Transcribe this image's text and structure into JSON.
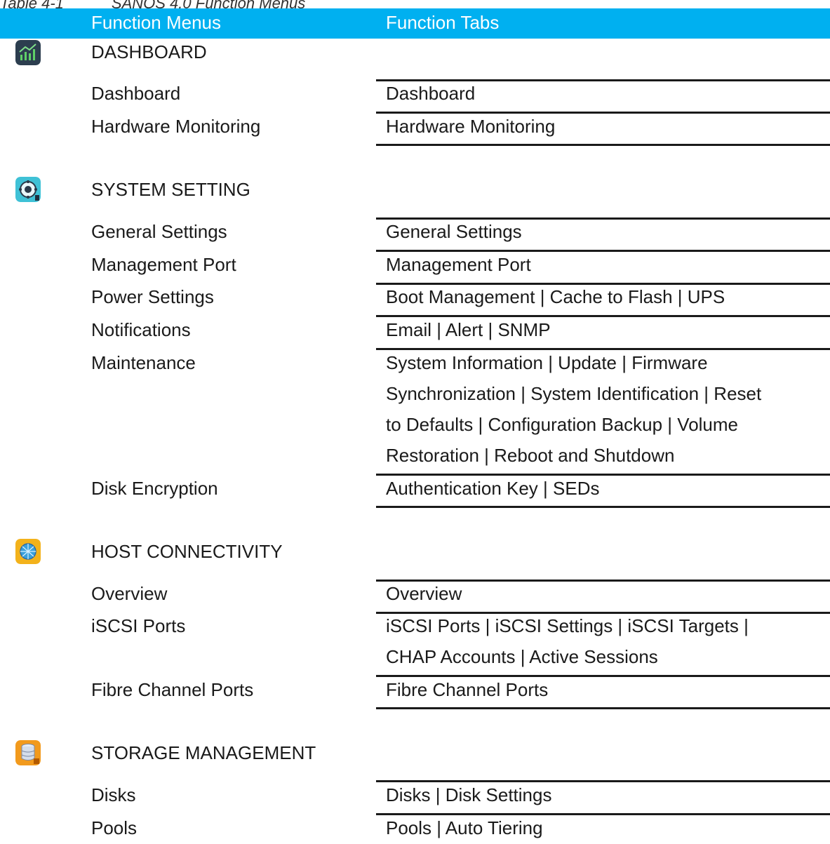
{
  "caption": {
    "number": "Table 4-1",
    "title": "SANOS 4.0 Function Menus"
  },
  "header": {
    "menus": "Function Menus",
    "tabs": "Function Tabs"
  },
  "sections": [
    {
      "title": "DASHBOARD",
      "icon": "dashboard-chart-icon",
      "rows": [
        {
          "menu": "Dashboard",
          "tabs": "Dashboard"
        },
        {
          "menu": "Hardware Monitoring",
          "tabs": "Hardware Monitoring"
        }
      ]
    },
    {
      "title": "SYSTEM SETTING",
      "icon": "system-setting-gear-icon",
      "rows": [
        {
          "menu": "General Settings",
          "tabs": "General Settings"
        },
        {
          "menu": "Management Port",
          "tabs": "Management Port"
        },
        {
          "menu": "Power Settings",
          "tabs": "Boot Management | Cache to Flash | UPS"
        },
        {
          "menu": "Notifications",
          "tabs": "Email | Alert | SNMP"
        },
        {
          "menu": "Maintenance",
          "tabs_lines": [
            "System Information | Update | Firmware",
            "Synchronization | System Identification | Reset",
            "to Defaults | Configuration Backup | Volume",
            "Restoration | Reboot and Shutdown"
          ]
        },
        {
          "menu": "Disk Encryption",
          "tabs": "Authentication Key | SEDs"
        }
      ]
    },
    {
      "title": "HOST CONNECTIVITY",
      "icon": "host-connectivity-globe-icon",
      "rows": [
        {
          "menu": "Overview",
          "tabs": "Overview"
        },
        {
          "menu": "iSCSI Ports",
          "tabs_lines": [
            "iSCSI Ports | iSCSI Settings | iSCSI Targets |",
            "CHAP Accounts | Active Sessions"
          ]
        },
        {
          "menu": "Fibre Channel Ports",
          "tabs": "Fibre Channel Ports"
        }
      ]
    },
    {
      "title": "STORAGE MANAGEMENT",
      "icon": "storage-database-icon",
      "rows": [
        {
          "menu": "Disks",
          "tabs": "Disks | Disk Settings"
        },
        {
          "menu": "Pools",
          "tabs": "Pools | Auto Tiering"
        }
      ]
    }
  ],
  "colors": {
    "header_bg": "#00b0f0",
    "header_text": "#ffffff",
    "rule": "#1a1a1a"
  }
}
